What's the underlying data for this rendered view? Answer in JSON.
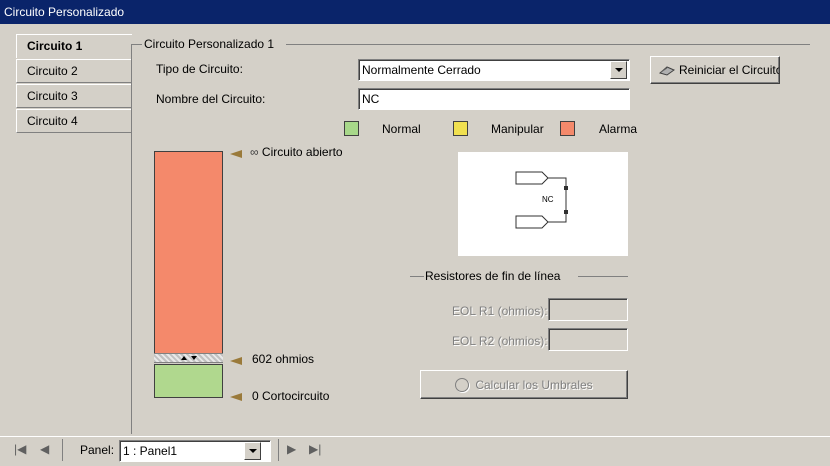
{
  "window": {
    "title": "Circuito Personalizado"
  },
  "tabs": [
    {
      "label": "Circuito 1"
    },
    {
      "label": "Circuito 2"
    },
    {
      "label": "Circuito 3"
    },
    {
      "label": "Circuito 4"
    }
  ],
  "group": {
    "title": "Circuito Personalizado 1"
  },
  "form": {
    "type_label": "Tipo de Circuito:",
    "type_value": "Normalmente Cerrado",
    "name_label": "Nombre del Circuito:",
    "name_value": "NC",
    "reset_button": "Reiniciar el Circuito"
  },
  "legend": [
    {
      "label": "Normal",
      "color": "#a8d88a"
    },
    {
      "label": "Manipular",
      "color": "#f0e050"
    },
    {
      "label": "Alarma",
      "color": "#f4896b"
    }
  ],
  "thresholds": {
    "open": "Circuito abierto",
    "open_symbol": "∞",
    "mid": "602 ohmios",
    "short": "0 Cortocircuito"
  },
  "diagram": {
    "label": "NC"
  },
  "eol": {
    "title": "Resistores de fin de línea",
    "r1_label": "EOL R1 (ohmios):",
    "r1_value": "",
    "r2_label": "EOL R2 (ohmios):",
    "r2_value": "",
    "calc_button": "Calcular los Umbrales"
  },
  "statusbar": {
    "panel_label": "Panel:",
    "panel_value": "1 : Panel1"
  }
}
